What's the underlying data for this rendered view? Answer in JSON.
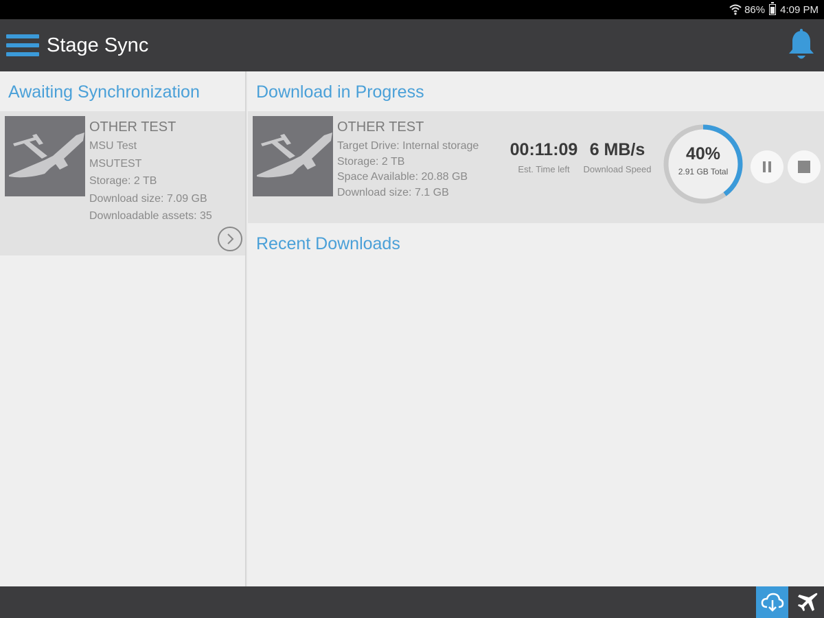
{
  "status_bar": {
    "battery": "86%",
    "time": "4:09 PM"
  },
  "app_bar": {
    "title": "Stage Sync"
  },
  "awaiting": {
    "heading": "Awaiting Synchronization",
    "item": {
      "title": "OTHER TEST",
      "lines": [
        "MSU Test",
        "MSUTEST",
        "Storage: 2 TB",
        "Download size: 7.09 GB",
        "Downloadable assets: 35"
      ]
    }
  },
  "in_progress": {
    "heading": "Download in Progress",
    "item": {
      "title": "OTHER TEST",
      "lines": [
        "Target Drive:  Internal storage",
        "Storage:  2 TB",
        "Space Available:  20.88 GB",
        "Download size:  7.1 GB"
      ],
      "time_left": "00:11:09",
      "time_left_label": "Est. Time left",
      "speed": "6 MB/s",
      "speed_label": "Download Speed",
      "percent_text": "40%",
      "progress": 0.4,
      "total": "2.91 GB Total"
    }
  },
  "recent": {
    "heading": "Recent Downloads"
  },
  "colors": {
    "accent": "#3b9ad9",
    "bar": "#3c3c3e"
  },
  "icons": [
    "menu-icon",
    "bell-icon",
    "chevron-right-icon",
    "pause-icon",
    "stop-icon",
    "cloud-download-icon",
    "airplane-icon"
  ]
}
